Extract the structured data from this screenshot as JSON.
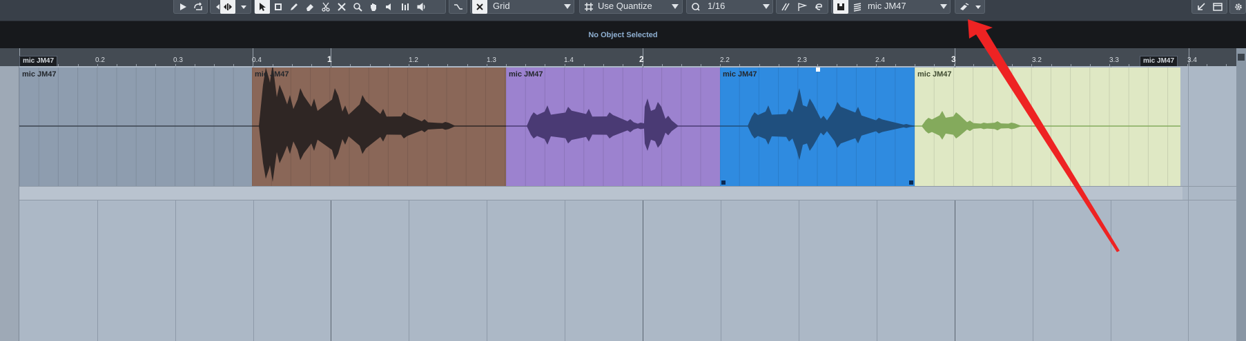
{
  "toolbar": {
    "snap_type": "Grid",
    "quantize_type": "Use Quantize",
    "quantize_value": "1/16",
    "track_name": "mic JM47"
  },
  "info_line": {
    "message": "No Object Selected"
  },
  "ruler": {
    "left_locator": "mic JM47",
    "right_locator": "mic JM47",
    "labels": [
      "0.2",
      "0.3",
      "0.4",
      "1",
      "1.2",
      "1.3",
      "1.4",
      "2",
      "2.2",
      "2.3",
      "2.4",
      "3",
      "3.2",
      "3.3",
      "3.4"
    ]
  },
  "events": [
    {
      "name": "mic JM47",
      "color": "#8e9daf",
      "wave_color": "#3a434e"
    },
    {
      "name": "mic JM47",
      "color": "#8a6758",
      "wave_color": "#2f2624"
    },
    {
      "name": "mic JM47",
      "color": "#9c82cf",
      "wave_color": "#4a3a74"
    },
    {
      "name": "mic JM47",
      "color": "#2f8be0",
      "wave_color": "#1f4f7e"
    },
    {
      "name": "mic JM47",
      "color": "#dfe8c4",
      "wave_color": "#84aa5c"
    }
  ],
  "annotation": {
    "color": "#ee2323"
  }
}
